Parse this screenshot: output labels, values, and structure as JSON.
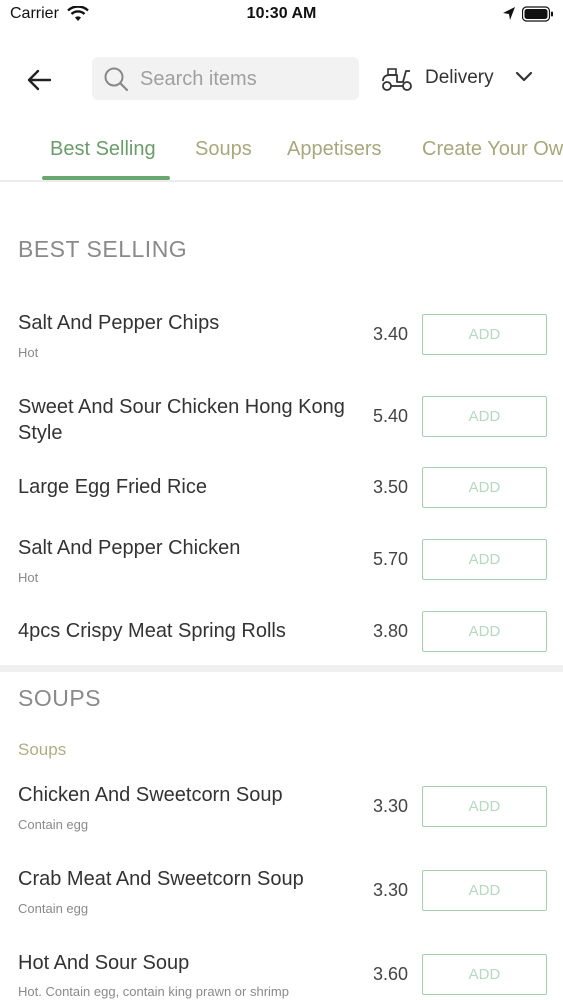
{
  "status_bar": {
    "carrier": "Carrier",
    "time": "10:30 AM"
  },
  "header": {
    "search_placeholder": "Search items",
    "delivery_label": "Delivery"
  },
  "tabs": [
    {
      "label": "Best Selling"
    },
    {
      "label": "Soups"
    },
    {
      "label": "Appetisers"
    },
    {
      "label": "Create Your Ow"
    }
  ],
  "sections": {
    "best_selling": {
      "title": "BEST SELLING",
      "items": [
        {
          "name": "Salt And Pepper Chips",
          "desc": "Hot",
          "price": "3.40",
          "add_label": "ADD"
        },
        {
          "name": "Sweet And Sour Chicken Hong Kong Style",
          "desc": "",
          "price": "5.40",
          "add_label": "ADD"
        },
        {
          "name": "Large Egg Fried Rice",
          "desc": "",
          "price": "3.50",
          "add_label": "ADD"
        },
        {
          "name": "Salt And Pepper Chicken",
          "desc": "Hot",
          "price": "5.70",
          "add_label": "ADD"
        },
        {
          "name": "4pcs Crispy Meat Spring Rolls",
          "desc": "",
          "price": "3.80",
          "add_label": "ADD"
        }
      ]
    },
    "soups": {
      "title": "SOUPS",
      "sub_heading": "Soups",
      "items": [
        {
          "name": "Chicken And Sweetcorn Soup",
          "desc": "Contain egg",
          "price": "3.30",
          "add_label": "ADD"
        },
        {
          "name": "Crab Meat And Sweetcorn Soup",
          "desc": "Contain egg",
          "price": "3.30",
          "add_label": "ADD"
        },
        {
          "name": "Hot And Sour Soup",
          "desc": "Hot. Contain egg, contain king prawn or shrimp",
          "price": "3.60",
          "add_label": "ADD"
        }
      ]
    }
  },
  "colors": {
    "accent_green": "#6aa86f",
    "tab_text": "#a8a77d",
    "add_border": "#a9ceb0"
  }
}
